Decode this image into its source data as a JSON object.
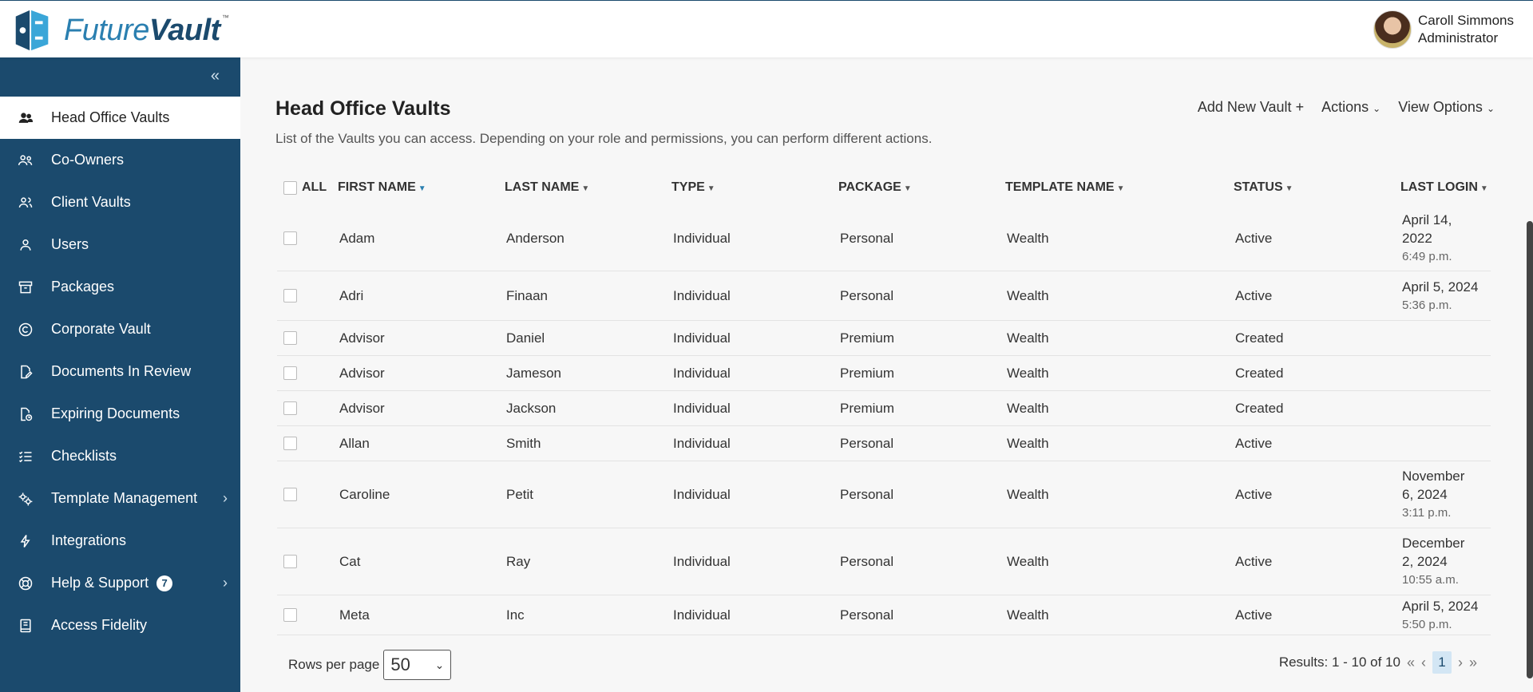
{
  "brand": {
    "name_future": "Future",
    "name_vault": "Vault",
    "tm": "™"
  },
  "user": {
    "name": "Caroll Simmons",
    "role": "Administrator"
  },
  "sidebar": {
    "items": [
      {
        "label": "Head Office Vaults",
        "icon": "users-group-icon",
        "active": true
      },
      {
        "label": "Co-Owners",
        "icon": "co-owners-icon"
      },
      {
        "label": "Client Vaults",
        "icon": "client-vaults-icon"
      },
      {
        "label": "Users",
        "icon": "user-icon"
      },
      {
        "label": "Packages",
        "icon": "archive-box-icon"
      },
      {
        "label": "Corporate Vault",
        "icon": "copyright-icon"
      },
      {
        "label": "Documents In Review",
        "icon": "document-edit-icon"
      },
      {
        "label": "Expiring Documents",
        "icon": "document-clock-icon"
      },
      {
        "label": "Checklists",
        "icon": "checklist-icon"
      },
      {
        "label": "Template Management",
        "icon": "gears-icon",
        "has_submenu": true
      },
      {
        "label": "Integrations",
        "icon": "lightning-icon"
      },
      {
        "label": "Help & Support",
        "icon": "lifebuoy-icon",
        "badge": "7",
        "has_submenu": true
      },
      {
        "label": "Access Fidelity",
        "icon": "book-icon"
      }
    ]
  },
  "main": {
    "title": "Head Office Vaults",
    "description": "List of the Vaults you can access. Depending on your role and permissions, you can perform different actions.",
    "toolbar": {
      "add": "Add New Vault",
      "add_icon": "+",
      "actions": "Actions",
      "view": "View Options"
    },
    "table": {
      "headers": {
        "all": "ALL",
        "first": "FIRST NAME",
        "last": "LAST NAME",
        "type": "TYPE",
        "package": "PACKAGE",
        "template": "TEMPLATE NAME",
        "status": "STATUS",
        "login": "LAST LOGIN"
      },
      "rows": [
        {
          "first": "Adam",
          "last": "Anderson",
          "type": "Individual",
          "package": "Personal",
          "template": "Wealth",
          "status": "Active",
          "login_date_1": "April 14,",
          "login_date_2": "2022",
          "login_time": "6:49 p.m."
        },
        {
          "first": "Adri",
          "last": "Finaan",
          "type": "Individual",
          "package": "Personal",
          "template": "Wealth",
          "status": "Active",
          "login_date_1": "April 5, 2024",
          "login_date_2": "",
          "login_time": "5:36 p.m."
        },
        {
          "first": "Advisor",
          "last": "Daniel",
          "type": "Individual",
          "package": "Premium",
          "template": "Wealth",
          "status": "Created",
          "login_date_1": "",
          "login_date_2": "",
          "login_time": ""
        },
        {
          "first": "Advisor",
          "last": "Jameson",
          "type": "Individual",
          "package": "Premium",
          "template": "Wealth",
          "status": "Created",
          "login_date_1": "",
          "login_date_2": "",
          "login_time": ""
        },
        {
          "first": "Advisor",
          "last": "Jackson",
          "type": "Individual",
          "package": "Premium",
          "template": "Wealth",
          "status": "Created",
          "login_date_1": "",
          "login_date_2": "",
          "login_time": ""
        },
        {
          "first": "Allan",
          "last": "Smith",
          "type": "Individual",
          "package": "Personal",
          "template": "Wealth",
          "status": "Active",
          "login_date_1": "",
          "login_date_2": "",
          "login_time": ""
        },
        {
          "first": "Caroline",
          "last": "Petit",
          "type": "Individual",
          "package": "Personal",
          "template": "Wealth",
          "status": "Active",
          "login_date_1": "November",
          "login_date_2": "6, 2024",
          "login_time": "3:11 p.m."
        },
        {
          "first": "Cat",
          "last": "Ray",
          "type": "Individual",
          "package": "Personal",
          "template": "Wealth",
          "status": "Active",
          "login_date_1": "December",
          "login_date_2": "2, 2024",
          "login_time": "10:55 a.m."
        },
        {
          "first": "Meta",
          "last": "Inc",
          "type": "Individual",
          "package": "Personal",
          "template": "Wealth",
          "status": "Active",
          "login_date_1": "April 5, 2024",
          "login_date_2": "",
          "login_time": "5:50 p.m."
        }
      ]
    },
    "footer": {
      "rows_label": "Rows per page",
      "rows_value": "50",
      "results": "Results: 1 - 10 of 10",
      "page": "1"
    }
  },
  "colors": {
    "sidebar": "#1b4a6d",
    "accent": "#2a7fb0",
    "active_page": "#d3e6f4"
  }
}
